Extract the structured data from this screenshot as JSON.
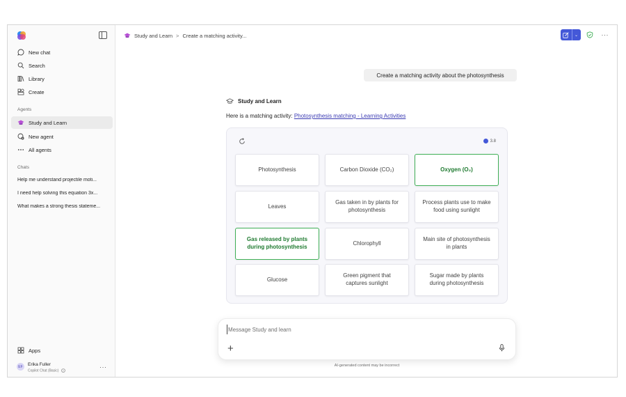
{
  "sidebar": {
    "nav": [
      {
        "label": "New chat",
        "icon": "chat-icon"
      },
      {
        "label": "Search",
        "icon": "search-icon"
      },
      {
        "label": "Library",
        "icon": "library-icon"
      },
      {
        "label": "Create",
        "icon": "create-icon"
      }
    ],
    "agents_label": "Agents",
    "agents": [
      {
        "label": "Study and Learn",
        "icon": "graduation-cap-icon",
        "active": true
      },
      {
        "label": "New agent",
        "icon": "new-agent-icon"
      },
      {
        "label": "All agents",
        "icon": "ellipsis-icon"
      }
    ],
    "chats_label": "Chats",
    "chats": [
      "Help me understand projectile moti...",
      "I need help solving this equation 3x...",
      "What makes a strong thesis stateme..."
    ],
    "apps_label": "Apps",
    "user": {
      "initials": "EF",
      "name": "Erika Fuller",
      "plan": "Copilot Chat (Basic)"
    }
  },
  "header": {
    "breadcrumb_agent": "Study and Learn",
    "breadcrumb_separator": ">",
    "breadcrumb_chat": "Create a matching activity..."
  },
  "conversation": {
    "user_message": "Create a matching activity about the photosynthesis",
    "agent_name": "Study and Learn",
    "intro_text": "Here is a matching activity: ",
    "intro_link": "Photosynthesis matching - Learning Activities"
  },
  "activity": {
    "timer": "3.8",
    "tiles": [
      {
        "text": "Photosynthesis",
        "matched": false
      },
      {
        "text": "Carbon Dioxide (CO₂)",
        "matched": false
      },
      {
        "text": "Oxygen (O₂)",
        "matched": true
      },
      {
        "text": "Leaves",
        "matched": false
      },
      {
        "text": "Gas taken in by plants for photosynthesis",
        "matched": false
      },
      {
        "text": "Process plants use to make food using sunlight",
        "matched": false
      },
      {
        "text": "Gas released by plants during photosynthesis",
        "matched": true
      },
      {
        "text": "Chlorophyll",
        "matched": false
      },
      {
        "text": "Main site of photosynthesis in plants",
        "matched": false
      },
      {
        "text": "Glucose",
        "matched": false
      },
      {
        "text": "Green pigment that captures sunlight",
        "matched": false
      },
      {
        "text": "Sugar made by plants during photosynthesis",
        "matched": false
      }
    ]
  },
  "composer": {
    "placeholder": "Message Study and learn",
    "disclaimer": "AI-generated content may be incorrect"
  },
  "colors": {
    "accent": "#4458d8",
    "matched_green": "#3eae55",
    "link": "#3b3bb3"
  }
}
